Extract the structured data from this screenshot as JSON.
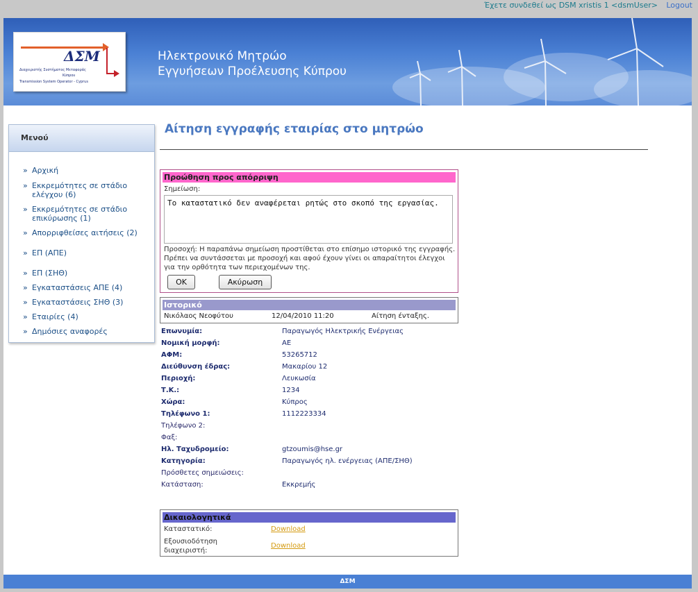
{
  "topbar": {
    "logged_in_as": "Έχετε συνδεθεί ως DSM xristis 1 <dsmUser>",
    "logout": "Logout"
  },
  "banner": {
    "logo_text": "ΔΣΜ",
    "logo_sub1": "Διαχειριστής Συστήματος Μεταφοράς",
    "logo_sub2": "Κύπρου",
    "logo_sub3": "Transmission System Operator - Cyprus",
    "title_line1": "Ηλεκτρονικό Μητρώο",
    "title_line2": "Εγγυήσεων Προέλευσης Κύπρου"
  },
  "sidebar": {
    "header": "Μενού",
    "items": [
      {
        "label": "Αρχική"
      },
      {
        "label": "Εκκρεμότητες σε στάδιο ελέγχου (6)"
      },
      {
        "label": "Εκκρεμότητες σε στάδιο επικύρωσης (1)"
      },
      {
        "label": "Απορριφθείσες αιτήσεις (2)"
      },
      {
        "label": "ΕΠ (ΑΠΕ)"
      },
      {
        "label": "ΕΠ (ΣΗΘ)"
      },
      {
        "label": "Εγκαταστάσεις ΑΠΕ (4)"
      },
      {
        "label": "Εγκαταστάσεις ΣΗΘ (3)"
      },
      {
        "label": "Εταιρίες (4)"
      },
      {
        "label": "Δημόσιες αναφορές"
      }
    ]
  },
  "main": {
    "page_title": "Αίτηση εγγραφής εταιρίας στο μητρώο"
  },
  "reject": {
    "header": "Προώθηση προς απόρριψη",
    "note_label": "Σημείωση:",
    "note_value": "Το καταστατικό δεν αναφέρεται ρητώς στο σκοπό της εργασίας.",
    "warning": "Προσοχή: Η παραπάνω σημείωση προστίθεται στο επίσημο ιστορικό της εγγραφής. Πρέπει να συντάσσεται με προσοχή και αφού έχουν γίνει οι απαραίτητοι έλεγχοι για την ορθότητα των περιεχομένων της.",
    "ok_label": "OK",
    "cancel_label": "Ακύρωση"
  },
  "history": {
    "header": "Ιστορικό",
    "rows": [
      {
        "user": "Νικόλαος Νεοφύτου",
        "date": "12/04/2010 11:20",
        "action": "Αίτηση ένταξης."
      }
    ]
  },
  "details": [
    {
      "label": "Επωνυμία:",
      "value": "Παραγωγός Ηλεκτρικής Ενέργειας",
      "bold": true
    },
    {
      "label": "Νομική μορφή:",
      "value": "ΑΕ",
      "bold": true
    },
    {
      "label": "ΑΦΜ:",
      "value": "53265712",
      "bold": true
    },
    {
      "label": "Διεύθυνση έδρας:",
      "value": "Μακαρίου 12",
      "bold": true
    },
    {
      "label": "Περιοχή:",
      "value": "Λευκωσία",
      "bold": true
    },
    {
      "label": "Τ.Κ.:",
      "value": "1234",
      "bold": true
    },
    {
      "label": "Χώρα:",
      "value": "Κύπρος",
      "bold": true
    },
    {
      "label": "Τηλέφωνο 1:",
      "value": "1112223334",
      "bold": true
    },
    {
      "label": "Τηλέφωνο 2:",
      "value": "",
      "bold": false
    },
    {
      "label": "Φαξ:",
      "value": "",
      "bold": false
    },
    {
      "label": "Ηλ. Ταχυδρομείο:",
      "value": "gtzoumis@hse.gr",
      "bold": true
    },
    {
      "label": "Κατηγορία:",
      "value": "Παραγωγός ηλ. ενέργειας (ΑΠΕ/ΣΗΘ)",
      "bold": true
    },
    {
      "label": "Πρόσθετες σημειώσεις:",
      "value": "",
      "bold": false
    },
    {
      "label": "Κατάσταση:",
      "value": "Εκκρεμής",
      "bold": false
    }
  ],
  "documents": {
    "header": "Δικαιολογητικά",
    "rows": [
      {
        "label": "Καταστατικό:",
        "link": "Download"
      },
      {
        "label_line1": "Εξουσιοδότηση",
        "label_line2": "διαχειριστή:",
        "link": "Download"
      }
    ]
  },
  "footer": {
    "text": "ΔΣΜ"
  }
}
